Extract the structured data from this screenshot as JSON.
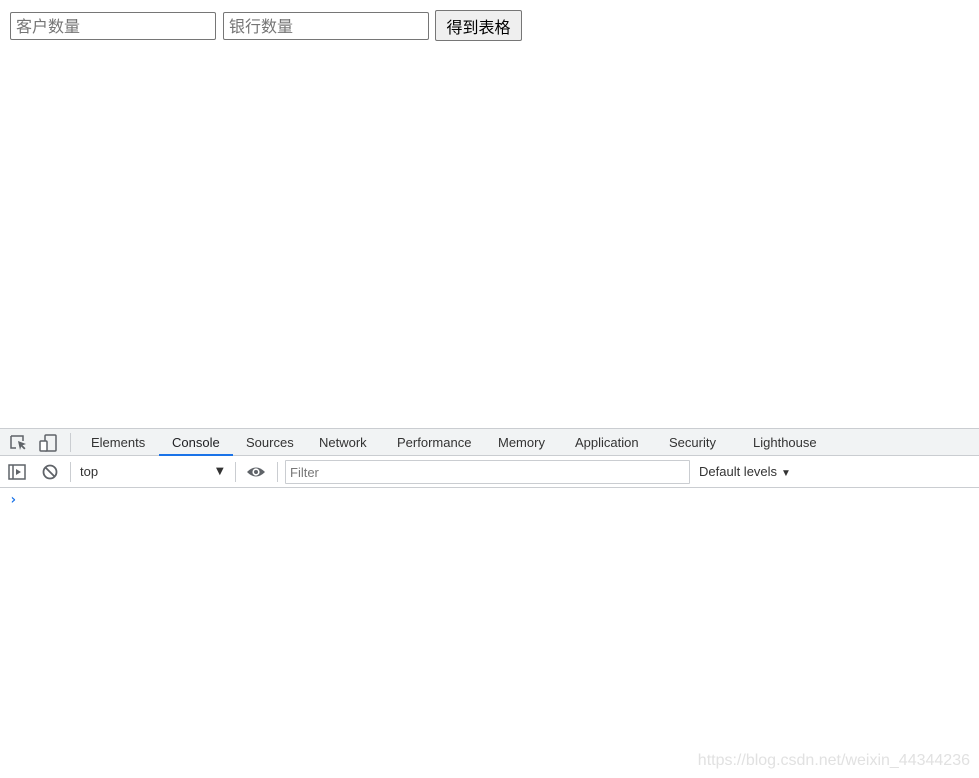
{
  "page": {
    "customer_input": {
      "placeholder": "客户数量",
      "value": ""
    },
    "bank_input": {
      "placeholder": "银行数量",
      "value": ""
    },
    "get_table_button": "得到表格"
  },
  "devtools": {
    "tabs": [
      {
        "label": "Elements",
        "active": false
      },
      {
        "label": "Console",
        "active": true
      },
      {
        "label": "Sources",
        "active": false
      },
      {
        "label": "Network",
        "active": false
      },
      {
        "label": "Performance",
        "active": false
      },
      {
        "label": "Memory",
        "active": false
      },
      {
        "label": "Application",
        "active": false
      },
      {
        "label": "Security",
        "active": false
      },
      {
        "label": "Lighthouse",
        "active": false
      }
    ],
    "toolbar": {
      "context": "top",
      "filter_placeholder": "Filter",
      "levels": "Default levels"
    },
    "prompt_symbol": "›",
    "accent_color": "#1a73e8"
  },
  "watermark": "https://blog.csdn.net/weixin_44344236"
}
